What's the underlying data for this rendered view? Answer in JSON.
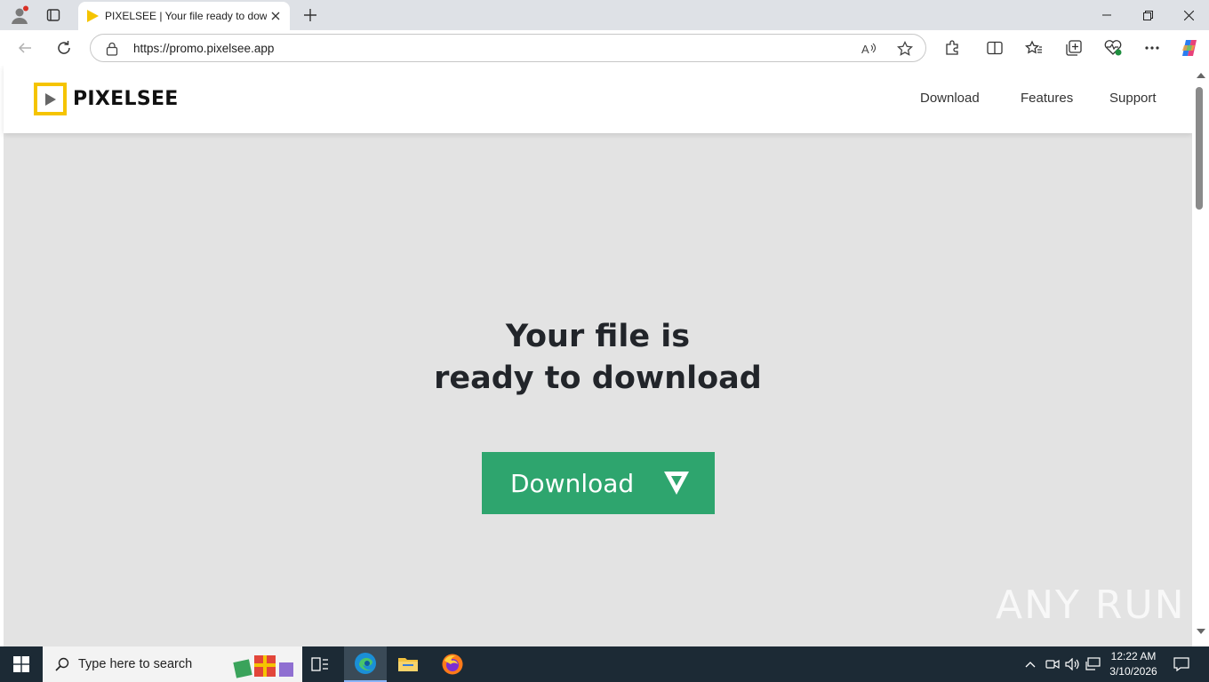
{
  "browser": {
    "tab_title": "PIXELSEE | Your file ready to download",
    "url_host": "https://promo.pixelsee.app"
  },
  "site": {
    "logo_text": "PIXELSEE",
    "nav": [
      "Download",
      "Features",
      "Support"
    ],
    "hero_line1": "Your file is",
    "hero_line2": "ready to download",
    "download_button": "Download",
    "accent_color": "#2ea56e",
    "logo_color": "#f5c400"
  },
  "watermark": "ANY RUN",
  "taskbar": {
    "search_placeholder": "Type here to search",
    "time": "12:22 AM",
    "date": "3/10/2026"
  }
}
